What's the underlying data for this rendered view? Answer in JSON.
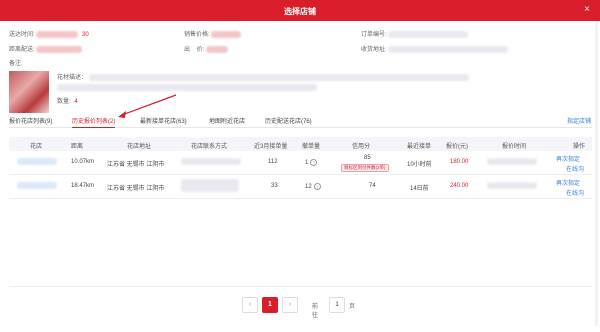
{
  "dialog": {
    "title": "选择店铺",
    "close": "×"
  },
  "info": {
    "delivery_time_label": "送达时间:",
    "delivery_time_value": "30",
    "distance_label": "距离配送:",
    "sale_price_label": "销售价格:",
    "out_price_label": "出    价:",
    "order_no_label": "订单编号:",
    "recipient_addr_label": "收货地址:",
    "remark_label": "备注:",
    "flower_desc_label": "花材描述：",
    "quantity_label": "数量:",
    "quantity_value": "4"
  },
  "tabs": [
    {
      "label": "报价花店列表(9)"
    },
    {
      "label": "历史报价列表(2)"
    },
    {
      "label": "最新接单花店(63)"
    },
    {
      "label": "地图附近花店"
    },
    {
      "label": "历史配送花店(76)"
    }
  ],
  "assign_link": "指定店铺",
  "table": {
    "headers": [
      "花店",
      "距离",
      "花店地址",
      "花店联系方式",
      "近3月接单量",
      "撤单量",
      "信用分",
      "最近接单",
      "报价(元)",
      "报价时间",
      "操作"
    ],
    "rows": [
      {
        "distance": "10.07km",
        "address": "江苏省 无锡市 江阴市",
        "orders": "112",
        "cancels": "1",
        "credit": "85",
        "badge": "目标区到付件数(2单)",
        "recent": "10小时前",
        "price": "180.00",
        "action1": "再次指定",
        "action2": "在线沟"
      },
      {
        "distance": "18.47km",
        "address": "江苏省 无锡市 江阴市",
        "orders": "33",
        "cancels": "12",
        "credit": "74",
        "badge": "",
        "recent": "14日前",
        "price": "240.00",
        "action1": "再次指定",
        "action2": "在线沟"
      }
    ]
  },
  "pager": {
    "prev": "‹",
    "current": "1",
    "next": "›",
    "goto_label": "前往",
    "goto_value": "1",
    "page_label": "页"
  }
}
